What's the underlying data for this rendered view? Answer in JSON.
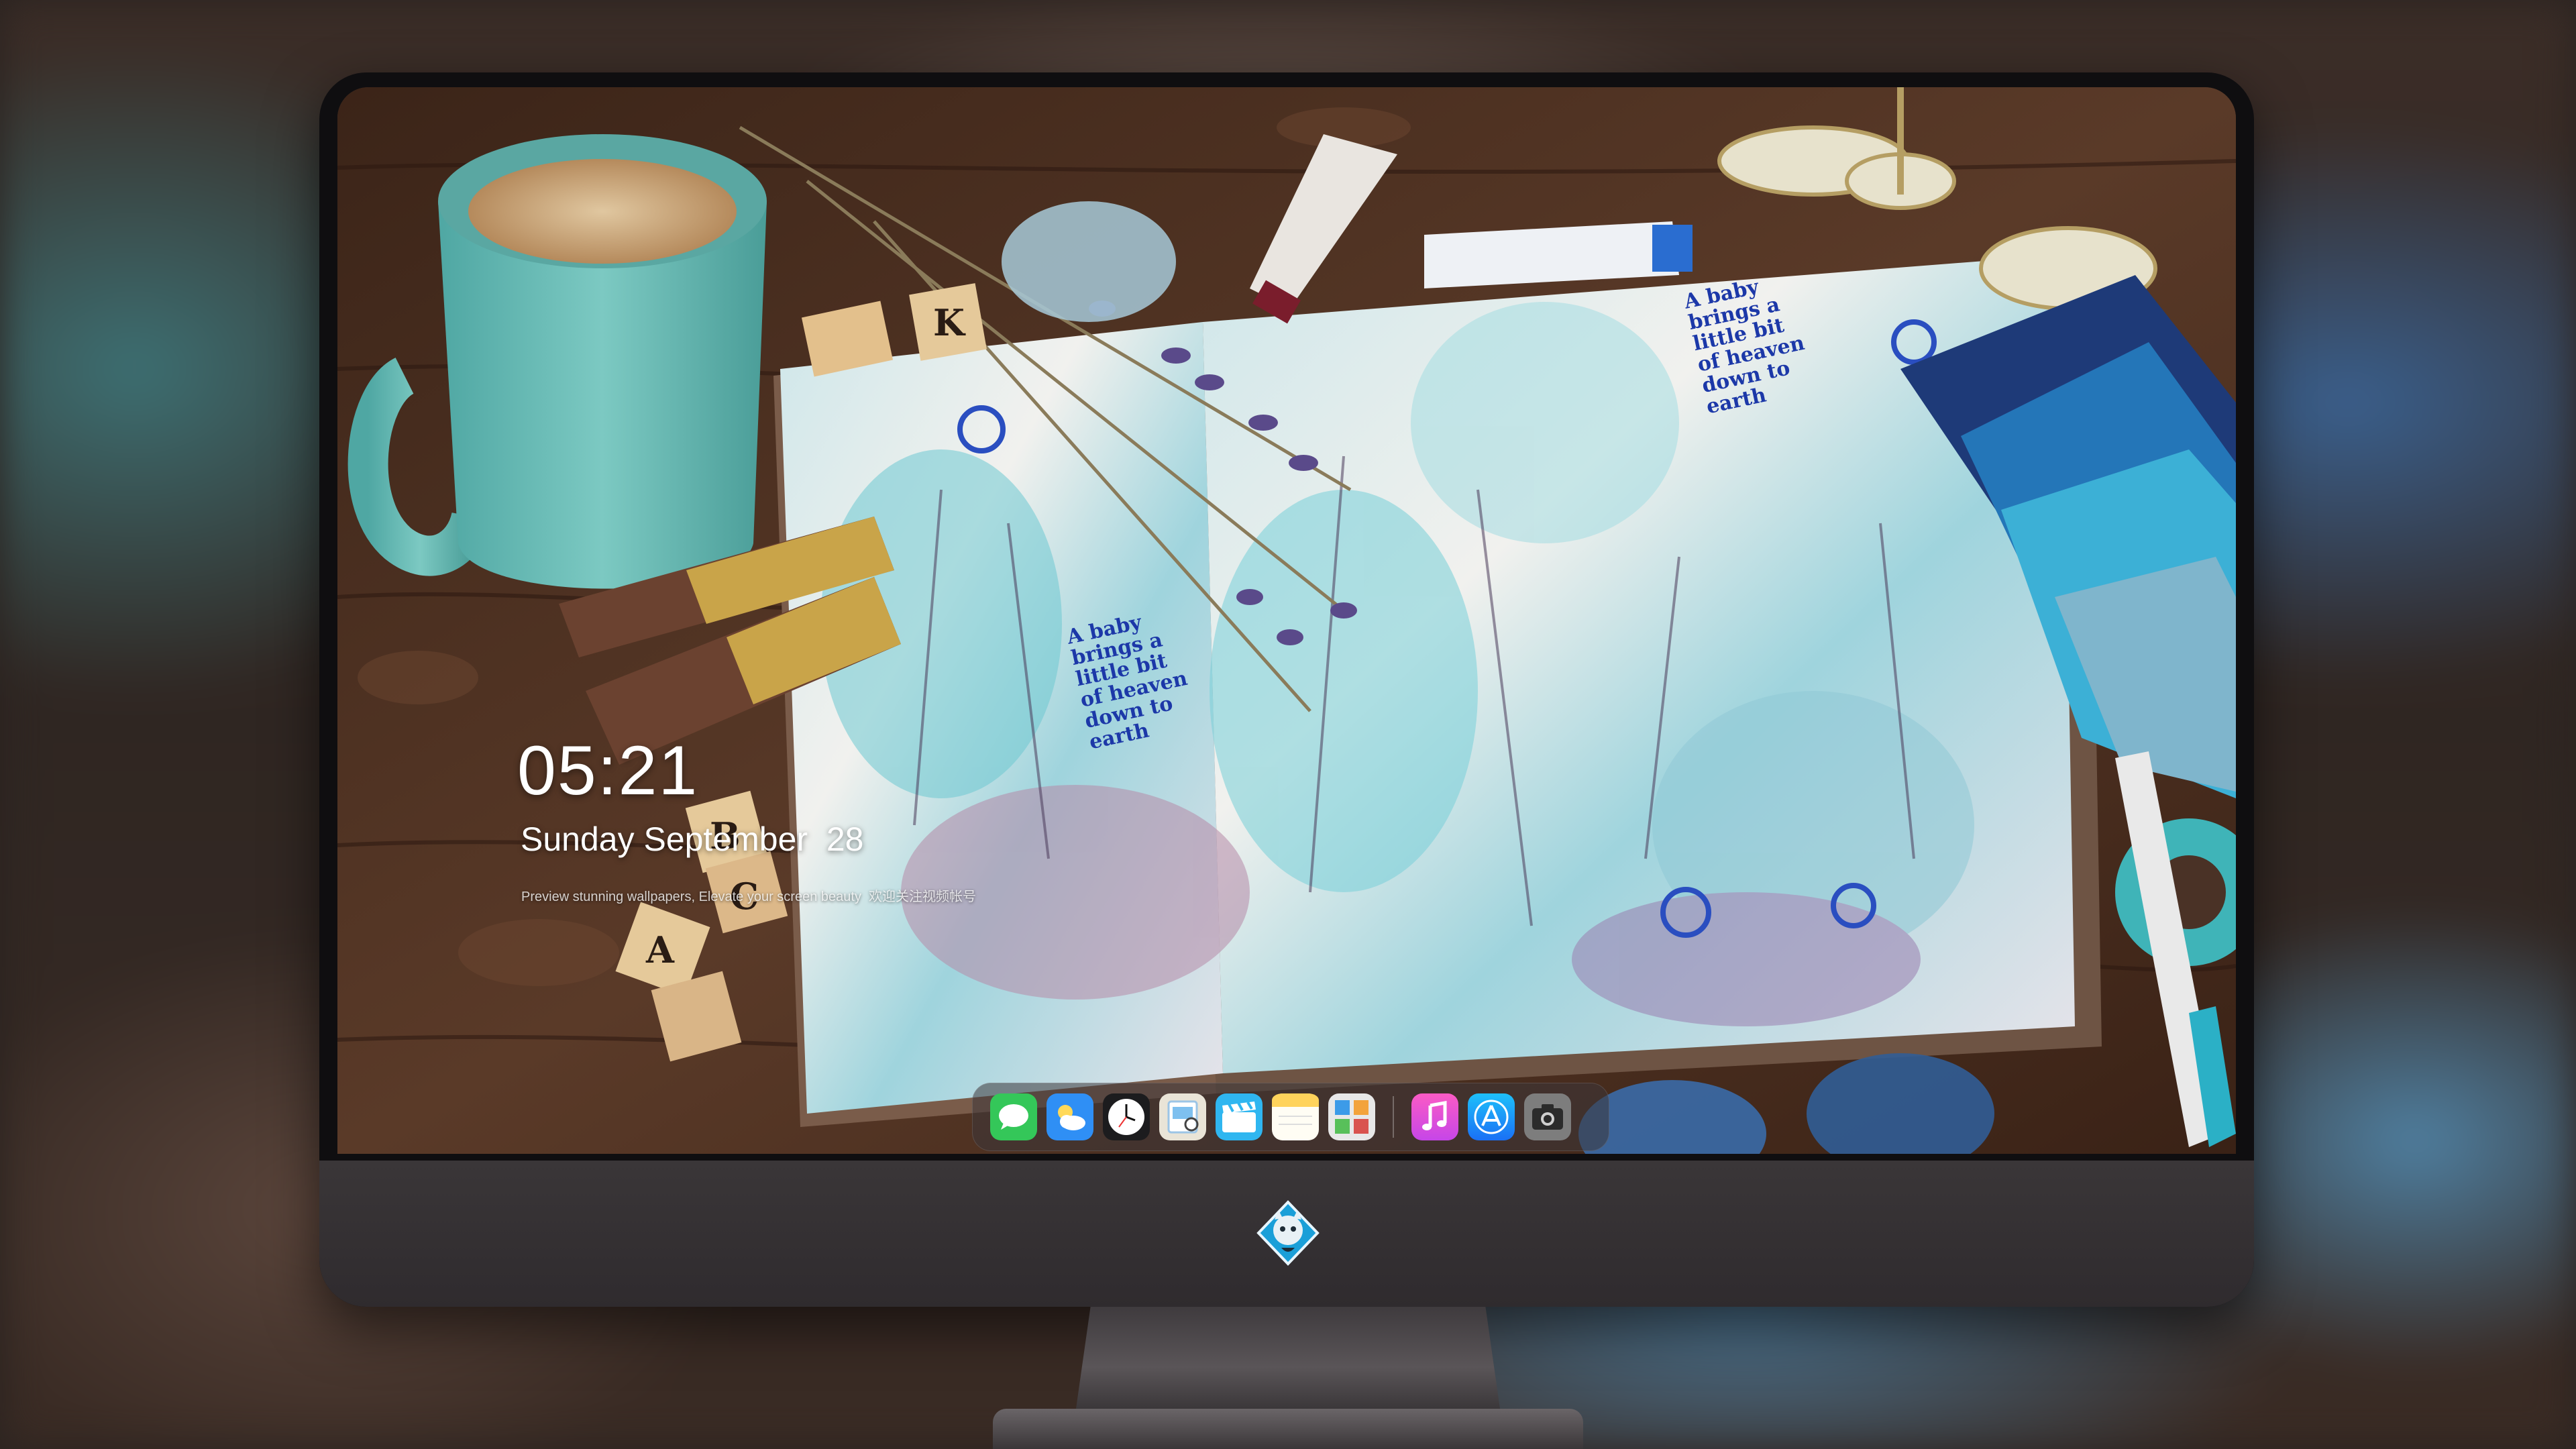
{
  "lockscreen": {
    "time": "05:21",
    "date": "Sunday September  28",
    "tagline": "Preview stunning wallpapers, Elevate your screen beauty  欢迎关注视频帐号"
  },
  "wallpaper": {
    "journal_text_left": [
      "A baby",
      "brings a",
      "little bit",
      "of heaven",
      "down to",
      "earth"
    ],
    "journal_text_right": [
      "A baby",
      "brings a",
      "little bit",
      "of heaven",
      "down to",
      "earth"
    ],
    "blocks": [
      "K",
      "B",
      "C",
      "A"
    ]
  },
  "dock": {
    "apps": [
      {
        "name": "messages",
        "icon": "messages-icon",
        "color": "#34c759"
      },
      {
        "name": "weather",
        "icon": "weather-icon",
        "color": "#2f8ff5"
      },
      {
        "name": "clock",
        "icon": "clock-icon",
        "color": "#ffffff"
      },
      {
        "name": "preview",
        "icon": "preview-icon",
        "color": "#e9e4d7"
      },
      {
        "name": "clips",
        "icon": "clips-icon",
        "color": "#2fb6f0"
      },
      {
        "name": "notes",
        "icon": "notes-icon",
        "color": "#ffd35b"
      },
      {
        "name": "photo-booth",
        "icon": "photo-booth-icon",
        "color": "#e8e8e8"
      },
      {
        "name": "music",
        "icon": "music-icon",
        "color": "#fb5bc5"
      },
      {
        "name": "app-store",
        "icon": "app-store-icon",
        "color": "#1c8ff7"
      },
      {
        "name": "camera",
        "icon": "camera-icon",
        "color": "#8c8c8c"
      }
    ]
  }
}
